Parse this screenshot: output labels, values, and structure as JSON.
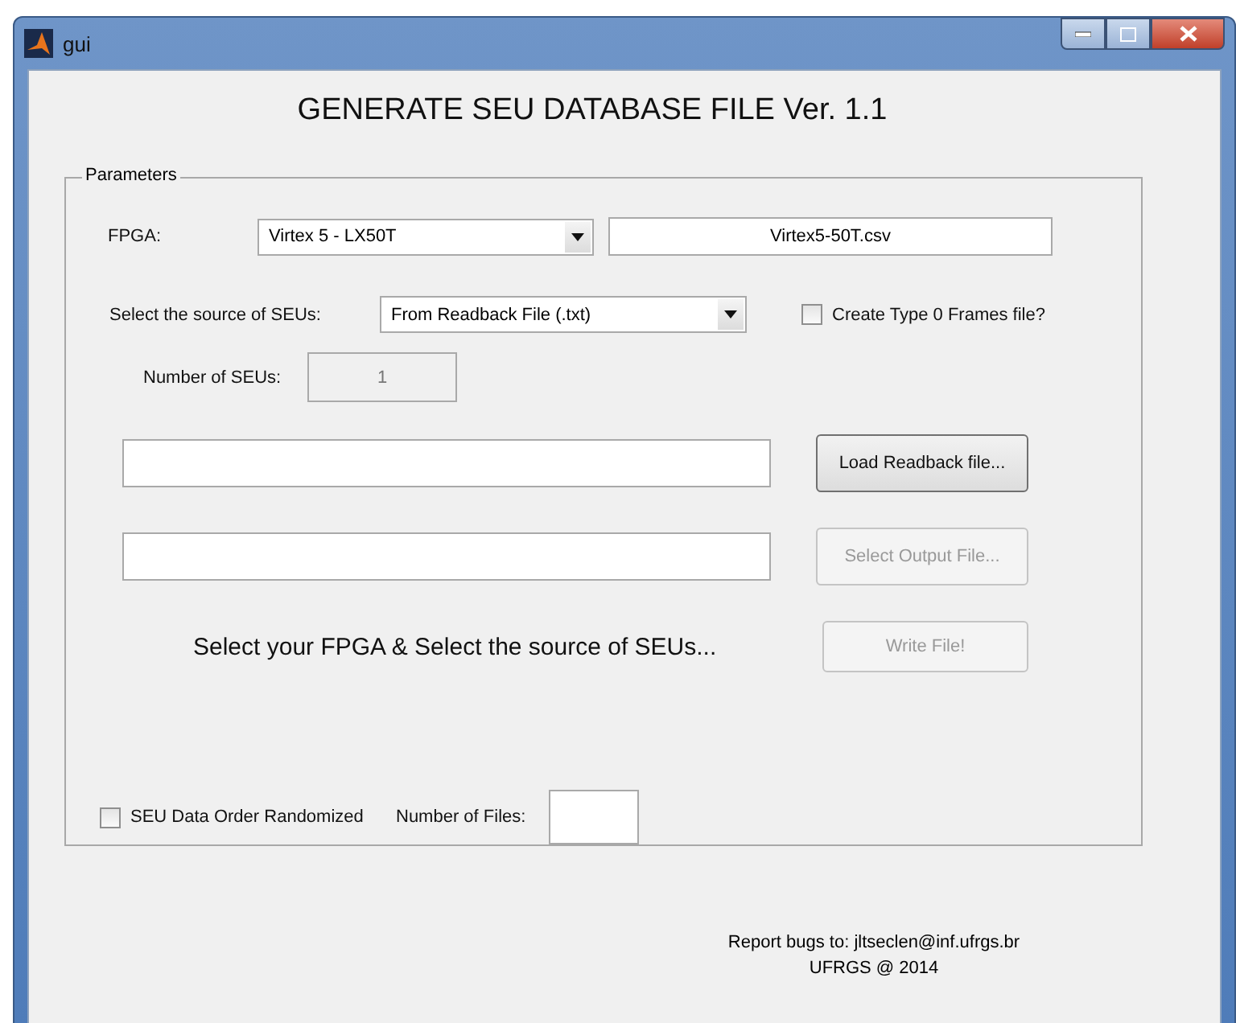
{
  "window": {
    "title": "gui"
  },
  "heading": "GENERATE SEU DATABASE FILE Ver. 1.1",
  "parameters": {
    "legend": "Parameters",
    "fpga": {
      "label": "FPGA:",
      "dropdown": "Virtex 5 - LX50T",
      "file": "Virtex5-50T.csv"
    },
    "source": {
      "label": "Select the source of SEUs:",
      "dropdown": "From Readback File (.txt)",
      "checkbox": {
        "label": "Create Type 0 Frames file?",
        "checked": false
      }
    },
    "seu_count": {
      "label": "Number of SEUs:",
      "value": "1",
      "disabled": true
    },
    "file_rows": [
      {
        "button": "Load Readback file...",
        "disabled": false
      },
      {
        "button": "Select Output File...",
        "disabled": true
      }
    ],
    "status": "Select your FPGA & Select the source of SEUs...",
    "write_button": {
      "label": "Write File!",
      "disabled": true
    },
    "randomized": {
      "label": "SEU Data Order Randomized",
      "checked": false
    },
    "files_count": {
      "label": "Number of Files:"
    }
  },
  "footer": [
    "Report bugs to: jltseclen@inf.ufrgs.br",
    "UFRGS @ 2014"
  ]
}
